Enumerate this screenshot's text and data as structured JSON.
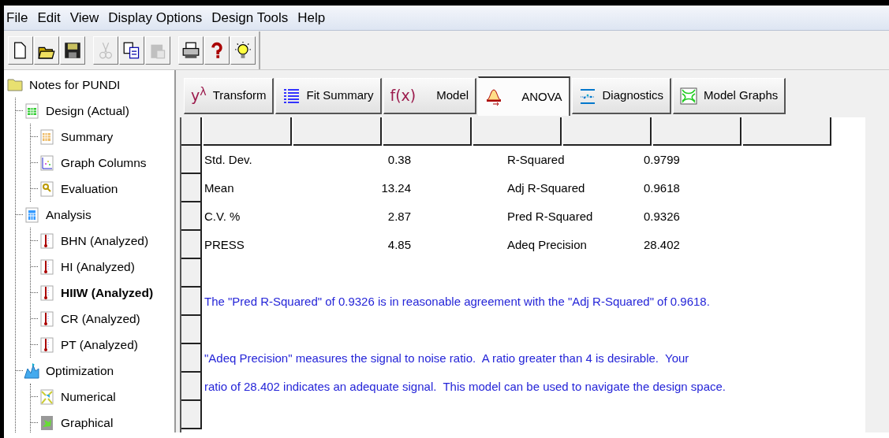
{
  "menu": [
    "File",
    "Edit",
    "View",
    "Display Options",
    "Design Tools",
    "Help"
  ],
  "toolbar": [
    [
      {
        "kind": "new",
        "disabled": false
      },
      {
        "kind": "open",
        "disabled": false
      },
      {
        "kind": "save",
        "disabled": false
      }
    ],
    [
      {
        "kind": "cut",
        "disabled": true
      },
      {
        "kind": "copy",
        "disabled": false
      },
      {
        "kind": "paste",
        "disabled": true
      }
    ],
    [
      {
        "kind": "print",
        "disabled": false
      },
      {
        "kind": "help",
        "disabled": false
      },
      {
        "kind": "tip",
        "disabled": false
      }
    ]
  ],
  "tree": [
    {
      "label": "Notes for PUNDI",
      "kind": "folder",
      "selected": false,
      "children": [
        {
          "label": "Design (Actual)",
          "kind": "grid",
          "selected": false,
          "children": [
            {
              "label": "Summary",
              "kind": "summary",
              "selected": false
            },
            {
              "label": "Graph Columns",
              "kind": "graph",
              "selected": false
            },
            {
              "label": "Evaluation",
              "kind": "eval",
              "selected": false
            }
          ]
        },
        {
          "label": "Analysis",
          "kind": "calc",
          "selected": false,
          "children": [
            {
              "label": "BHN (Analyzed)",
              "kind": "thermo",
              "selected": false
            },
            {
              "label": "HI (Analyzed)",
              "kind": "thermo",
              "selected": false
            },
            {
              "label": "HIIW (Analyzed)",
              "kind": "thermo",
              "selected": true
            },
            {
              "label": "CR (Analyzed)",
              "kind": "thermo",
              "selected": false
            },
            {
              "label": "PT (Analyzed)",
              "kind": "thermo",
              "selected": false
            }
          ]
        },
        {
          "label": "Optimization",
          "kind": "optim",
          "selected": false,
          "children": [
            {
              "label": "Numerical",
              "kind": "numeric",
              "selected": false
            },
            {
              "label": "Graphical",
              "kind": "graphic",
              "selected": false
            }
          ]
        }
      ]
    }
  ],
  "tabs": [
    {
      "label": "Transform",
      "glyph": "y$^{λ}$",
      "selected": false
    },
    {
      "label": "Fit Summary",
      "kind": "list",
      "selected": false
    },
    {
      "label": "Model",
      "glyph": "f(x)",
      "selected": false
    },
    {
      "label": "ANOVA",
      "kind": "anova",
      "selected": true
    },
    {
      "label": "Diagnostics",
      "kind": "diag",
      "selected": false
    },
    {
      "label": "Model Graphs",
      "kind": "contour",
      "selected": false
    }
  ],
  "stats": [
    {
      "label": "Std. Dev.",
      "value": "0.38",
      "label_2": "R-Squared",
      "value_2": "0.9799"
    },
    {
      "label": "Mean",
      "value": "13.24",
      "label_2": "Adj R-Squared",
      "value_2": "0.9618"
    },
    {
      "label": "C.V. %",
      "value": "2.87",
      "label_2": "Pred R-Squared",
      "value_2": "0.9326"
    },
    {
      "label": "PRESS",
      "value": "4.85",
      "label_2": "Adeq Precision",
      "value_2": "28.402"
    }
  ],
  "notes": [
    {
      "kind": "blank"
    },
    {
      "kind": "text",
      "text": "The \"Pred R-Squared\" of 0.9326 is in reasonable agreement with the \"Adj R-Squared\" of 0.9618."
    },
    {
      "kind": "blank"
    },
    {
      "kind": "text",
      "text": "\"Adeq Precision\" measures the signal to noise ratio.  A ratio greater than 4 is desirable.  Your"
    },
    {
      "kind": "text",
      "text": "ratio of 28.402 indicates an adequate signal.  This model can be used to navigate the design space."
    },
    {
      "kind": "blank"
    }
  ]
}
